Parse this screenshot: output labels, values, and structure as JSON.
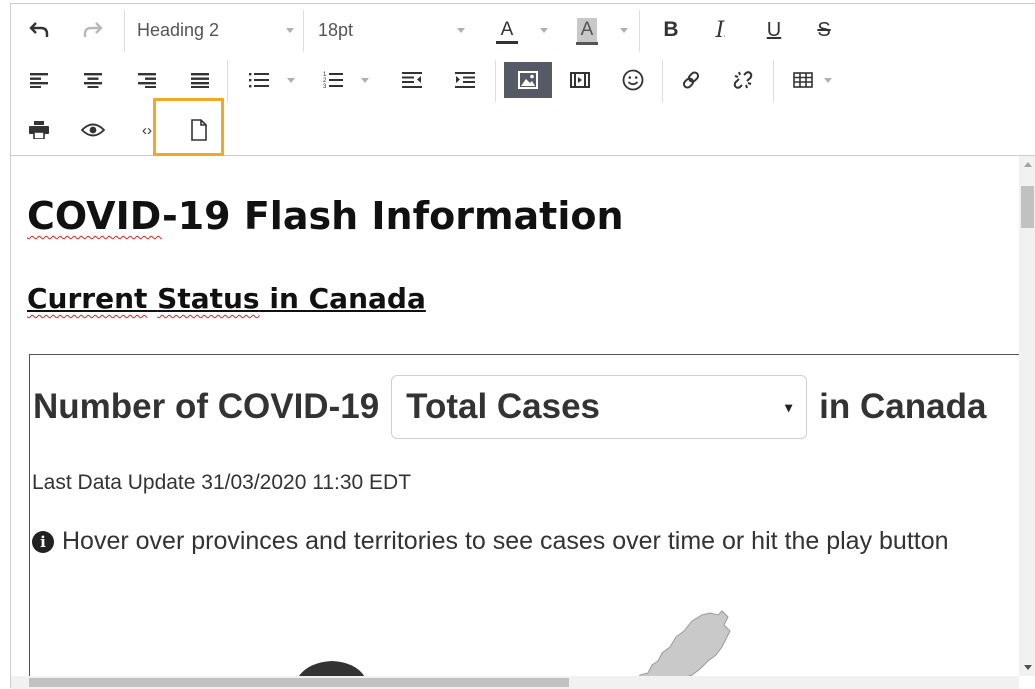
{
  "toolbar": {
    "block_format": "Heading 2",
    "font_size": "18pt",
    "text_color_glyph": "A",
    "background_color_glyph": "A",
    "bold_glyph": "B",
    "italic_glyph": "I",
    "underline_glyph": "U",
    "strikethrough_glyph": "S",
    "code_glyph": "‹›",
    "accent_color": "#f5a623",
    "active_button_color": "#555a66"
  },
  "content": {
    "heading": {
      "spell_part": "COVID",
      "rest": "-19 Flash Information"
    },
    "subheading": {
      "spell_part": "Current",
      "space": " ",
      "spell_part2": "Status",
      "rest": " in Canada"
    },
    "embed": {
      "title_prefix": "Number of COVID-19",
      "dropdown_value": "Total Cases",
      "title_suffix": "in Canada",
      "last_update": "Last Data Update 31/03/2020 11:30 EDT",
      "info_glyph": "i",
      "hint": "Hover over provinces and territories to see cases over time or hit the play button"
    }
  }
}
